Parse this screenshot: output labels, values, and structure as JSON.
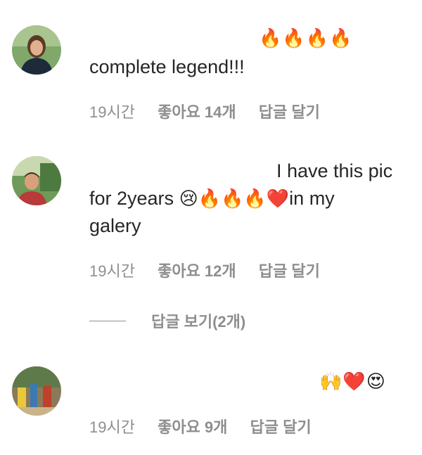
{
  "comments": [
    {
      "emojis": "🔥🔥🔥🔥",
      "text": "complete legend!!!",
      "time": "19시간",
      "likes": "좋아요 14개",
      "reply": "답글 달기"
    },
    {
      "text_line1": "I have this pic",
      "text_line2_pre": "for 2years ",
      "text_line2_emojis": "😢🔥🔥🔥❤️",
      "text_line2_post": "in my",
      "text_line3": "galery",
      "time": "19시간",
      "likes": "좋아요 12개",
      "reply": "답글 달기",
      "view_replies": "답글 보기(2개)"
    },
    {
      "emojis": "🙌❤️😍",
      "time": "19시간",
      "likes": "좋아요 9개",
      "reply": "답글 달기"
    }
  ]
}
